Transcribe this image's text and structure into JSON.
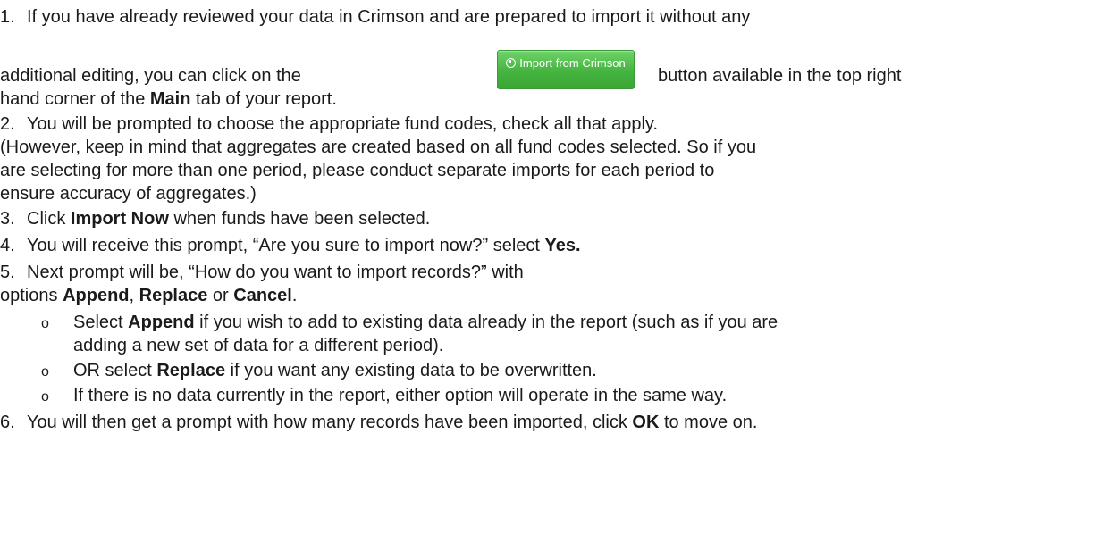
{
  "steps": {
    "s1": {
      "num": "1.",
      "line1": "If you have already reviewed your data in Crimson and are prepared to import it without any",
      "line2_pre": "additional editing, you can click on the",
      "line2_post": "button available in the top right",
      "line3_pre": "hand corner of the ",
      "line3_bold": "Main",
      "line3_post": " tab of your report."
    },
    "button": {
      "label": "Import from Crimson",
      "icon": "info-circle-icon",
      "color": "#45b43f"
    },
    "s2": {
      "num": "2.",
      "line1": "You will be prompted to choose the appropriate fund codes, check all that apply.",
      "line2": "(However, keep in mind that aggregates are created based on all fund codes selected. So if you",
      "line3": "are selecting for more than one period, please conduct separate imports for each period to",
      "line4": "ensure accuracy of aggregates.)"
    },
    "s3": {
      "num": "3.",
      "pre": "Click ",
      "bold": "Import Now",
      "post": " when funds have been selected."
    },
    "s4": {
      "num": "4.",
      "pre": "You will receive this prompt, “Are you sure to import now?” select ",
      "bold": "Yes."
    },
    "s5": {
      "num": "5.",
      "line1": "Next prompt will be, “How do you want to import records?” with",
      "line2_pre": "options ",
      "line2_b1": "Append",
      "line2_m1": ", ",
      "line2_b2": "Replace",
      "line2_m2": " or ",
      "line2_b3": "Cancel",
      "line2_post": ".",
      "bullets": {
        "b1_pre": "Select ",
        "b1_bold": "Append",
        "b1_post": " if you wish to add to existing data already in the report (such as if you are",
        "b1_cont": "adding a new set of data for a different period).",
        "b2_pre": "OR select ",
        "b2_bold": "Replace",
        "b2_post": " if you want any existing data to be overwritten.",
        "b3": "If there is no data currently in the report, either option will operate in the same way.",
        "marker": "o"
      }
    },
    "s6": {
      "num": "6.",
      "pre": "You will then get a prompt with how many records have been imported, click ",
      "bold": "OK",
      "post": " to move on."
    }
  }
}
